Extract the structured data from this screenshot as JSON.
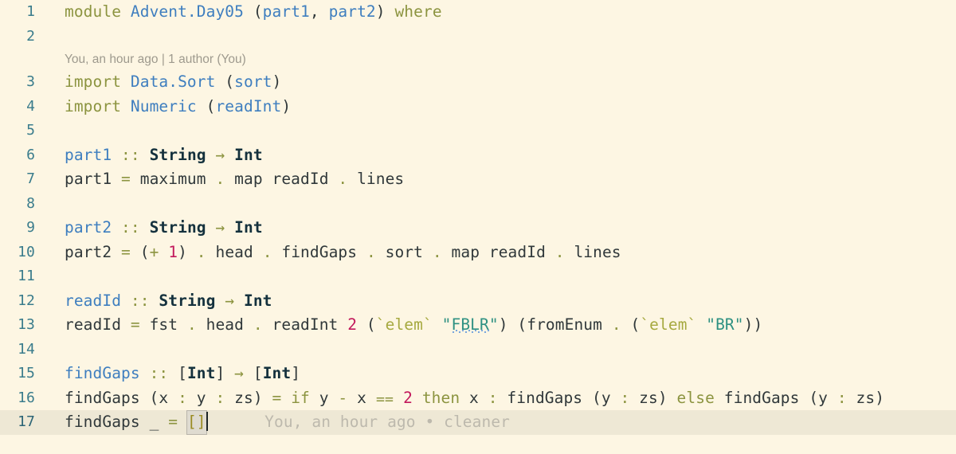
{
  "editor": {
    "language": "Haskell",
    "theme_background": "#fdf6e3",
    "current_line_background": "#eee8d5",
    "gutter_color": "#3a7c8c",
    "codelens": {
      "text": "You, an hour ago | 1 author (You)",
      "above_line": 3
    },
    "inline_blame": {
      "text": "You, an hour ago • cleaner",
      "on_line": 17
    },
    "cursor": {
      "line": 17,
      "column": 24
    },
    "lines": [
      {
        "number": "1",
        "tokens": [
          {
            "t": "module",
            "c": "kw"
          },
          {
            "t": " ",
            "c": "plain"
          },
          {
            "t": "Advent.Day05",
            "c": "mod"
          },
          {
            "t": " (",
            "c": "paren"
          },
          {
            "t": "part1",
            "c": "mod"
          },
          {
            "t": ", ",
            "c": "paren"
          },
          {
            "t": "part2",
            "c": "mod"
          },
          {
            "t": ") ",
            "c": "paren"
          },
          {
            "t": "where",
            "c": "kw"
          }
        ]
      },
      {
        "number": "2",
        "tokens": []
      },
      {
        "number": "3",
        "tokens": [
          {
            "t": "import",
            "c": "kw"
          },
          {
            "t": " ",
            "c": "plain"
          },
          {
            "t": "Data.Sort",
            "c": "mod"
          },
          {
            "t": " (",
            "c": "paren"
          },
          {
            "t": "sort",
            "c": "mod"
          },
          {
            "t": ")",
            "c": "paren"
          }
        ]
      },
      {
        "number": "4",
        "tokens": [
          {
            "t": "import",
            "c": "kw"
          },
          {
            "t": " ",
            "c": "plain"
          },
          {
            "t": "Numeric",
            "c": "mod"
          },
          {
            "t": " (",
            "c": "paren"
          },
          {
            "t": "readInt",
            "c": "mod"
          },
          {
            "t": ")",
            "c": "paren"
          }
        ]
      },
      {
        "number": "5",
        "tokens": []
      },
      {
        "number": "6",
        "tokens": [
          {
            "t": "part1",
            "c": "fn"
          },
          {
            "t": " ",
            "c": "plain"
          },
          {
            "t": "::",
            "c": "op"
          },
          {
            "t": " ",
            "c": "plain"
          },
          {
            "t": "String",
            "c": "typ"
          },
          {
            "t": " ",
            "c": "plain"
          },
          {
            "t": "→",
            "c": "op"
          },
          {
            "t": " ",
            "c": "plain"
          },
          {
            "t": "Int",
            "c": "typ"
          }
        ]
      },
      {
        "number": "7",
        "tokens": [
          {
            "t": "part1 ",
            "c": "plain"
          },
          {
            "t": "=",
            "c": "op"
          },
          {
            "t": " maximum ",
            "c": "plain"
          },
          {
            "t": ".",
            "c": "op"
          },
          {
            "t": " map readId ",
            "c": "plain"
          },
          {
            "t": ".",
            "c": "op"
          },
          {
            "t": " lines",
            "c": "plain"
          }
        ]
      },
      {
        "number": "8",
        "tokens": []
      },
      {
        "number": "9",
        "tokens": [
          {
            "t": "part2",
            "c": "fn"
          },
          {
            "t": " ",
            "c": "plain"
          },
          {
            "t": "::",
            "c": "op"
          },
          {
            "t": " ",
            "c": "plain"
          },
          {
            "t": "String",
            "c": "typ"
          },
          {
            "t": " ",
            "c": "plain"
          },
          {
            "t": "→",
            "c": "op"
          },
          {
            "t": " ",
            "c": "plain"
          },
          {
            "t": "Int",
            "c": "typ"
          }
        ]
      },
      {
        "number": "10",
        "tokens": [
          {
            "t": "part2 ",
            "c": "plain"
          },
          {
            "t": "=",
            "c": "op"
          },
          {
            "t": " (",
            "c": "paren"
          },
          {
            "t": "+",
            "c": "op"
          },
          {
            "t": " ",
            "c": "plain"
          },
          {
            "t": "1",
            "c": "num"
          },
          {
            "t": ") ",
            "c": "paren"
          },
          {
            "t": ".",
            "c": "op"
          },
          {
            "t": " head ",
            "c": "plain"
          },
          {
            "t": ".",
            "c": "op"
          },
          {
            "t": " findGaps ",
            "c": "plain"
          },
          {
            "t": ".",
            "c": "op"
          },
          {
            "t": " sort ",
            "c": "plain"
          },
          {
            "t": ".",
            "c": "op"
          },
          {
            "t": " map readId ",
            "c": "plain"
          },
          {
            "t": ".",
            "c": "op"
          },
          {
            "t": " lines",
            "c": "plain"
          }
        ]
      },
      {
        "number": "11",
        "tokens": []
      },
      {
        "number": "12",
        "tokens": [
          {
            "t": "readId",
            "c": "fn"
          },
          {
            "t": " ",
            "c": "plain"
          },
          {
            "t": "::",
            "c": "op"
          },
          {
            "t": " ",
            "c": "plain"
          },
          {
            "t": "String",
            "c": "typ"
          },
          {
            "t": " ",
            "c": "plain"
          },
          {
            "t": "→",
            "c": "op"
          },
          {
            "t": " ",
            "c": "plain"
          },
          {
            "t": "Int",
            "c": "typ"
          }
        ]
      },
      {
        "number": "13",
        "tokens": [
          {
            "t": "readId ",
            "c": "plain"
          },
          {
            "t": "=",
            "c": "op"
          },
          {
            "t": " fst ",
            "c": "plain"
          },
          {
            "t": ".",
            "c": "op"
          },
          {
            "t": " head ",
            "c": "plain"
          },
          {
            "t": ".",
            "c": "op"
          },
          {
            "t": " readInt ",
            "c": "plain"
          },
          {
            "t": "2",
            "c": "num"
          },
          {
            "t": " (",
            "c": "paren"
          },
          {
            "t": "`elem`",
            "c": "bq"
          },
          {
            "t": " ",
            "c": "plain"
          },
          {
            "t": "\"",
            "c": "str"
          },
          {
            "t": "FBLR",
            "c": "str squiggle"
          },
          {
            "t": "\"",
            "c": "str"
          },
          {
            "t": ") (",
            "c": "paren"
          },
          {
            "t": "fromEnum ",
            "c": "plain"
          },
          {
            "t": ".",
            "c": "op"
          },
          {
            "t": " (",
            "c": "paren"
          },
          {
            "t": "`elem`",
            "c": "bq"
          },
          {
            "t": " ",
            "c": "plain"
          },
          {
            "t": "\"BR\"",
            "c": "str"
          },
          {
            "t": "))",
            "c": "paren"
          }
        ]
      },
      {
        "number": "14",
        "tokens": []
      },
      {
        "number": "15",
        "tokens": [
          {
            "t": "findGaps",
            "c": "fn"
          },
          {
            "t": " ",
            "c": "plain"
          },
          {
            "t": "::",
            "c": "op"
          },
          {
            "t": " [",
            "c": "paren"
          },
          {
            "t": "Int",
            "c": "typ"
          },
          {
            "t": "] ",
            "c": "paren"
          },
          {
            "t": "→",
            "c": "op"
          },
          {
            "t": " [",
            "c": "paren"
          },
          {
            "t": "Int",
            "c": "typ"
          },
          {
            "t": "]",
            "c": "paren"
          }
        ]
      },
      {
        "number": "16",
        "tokens": [
          {
            "t": "findGaps (x ",
            "c": "plain"
          },
          {
            "t": ":",
            "c": "op"
          },
          {
            "t": " y ",
            "c": "plain"
          },
          {
            "t": ":",
            "c": "op"
          },
          {
            "t": " zs) ",
            "c": "plain"
          },
          {
            "t": "=",
            "c": "op"
          },
          {
            "t": " ",
            "c": "plain"
          },
          {
            "t": "if",
            "c": "kw"
          },
          {
            "t": " y ",
            "c": "plain"
          },
          {
            "t": "-",
            "c": "op"
          },
          {
            "t": " x ",
            "c": "plain"
          },
          {
            "t": "⩵",
            "c": "op"
          },
          {
            "t": " ",
            "c": "plain"
          },
          {
            "t": "2",
            "c": "num"
          },
          {
            "t": " ",
            "c": "plain"
          },
          {
            "t": "then",
            "c": "kw"
          },
          {
            "t": " x ",
            "c": "plain"
          },
          {
            "t": ":",
            "c": "op"
          },
          {
            "t": " findGaps (y ",
            "c": "plain"
          },
          {
            "t": ":",
            "c": "op"
          },
          {
            "t": " zs) ",
            "c": "plain"
          },
          {
            "t": "else",
            "c": "kw"
          },
          {
            "t": " findGaps (y ",
            "c": "plain"
          },
          {
            "t": ":",
            "c": "op"
          },
          {
            "t": " zs)",
            "c": "plain"
          }
        ]
      },
      {
        "number": "17",
        "tokens": [
          {
            "t": "findGaps ",
            "c": "plain"
          },
          {
            "t": "_",
            "c": "plain"
          },
          {
            "t": " ",
            "c": "plain"
          },
          {
            "t": "=",
            "c": "op"
          },
          {
            "t": " ",
            "c": "plain"
          },
          {
            "t": "[]",
            "c": "brk bracketbox"
          }
        ],
        "current": true
      }
    ]
  }
}
